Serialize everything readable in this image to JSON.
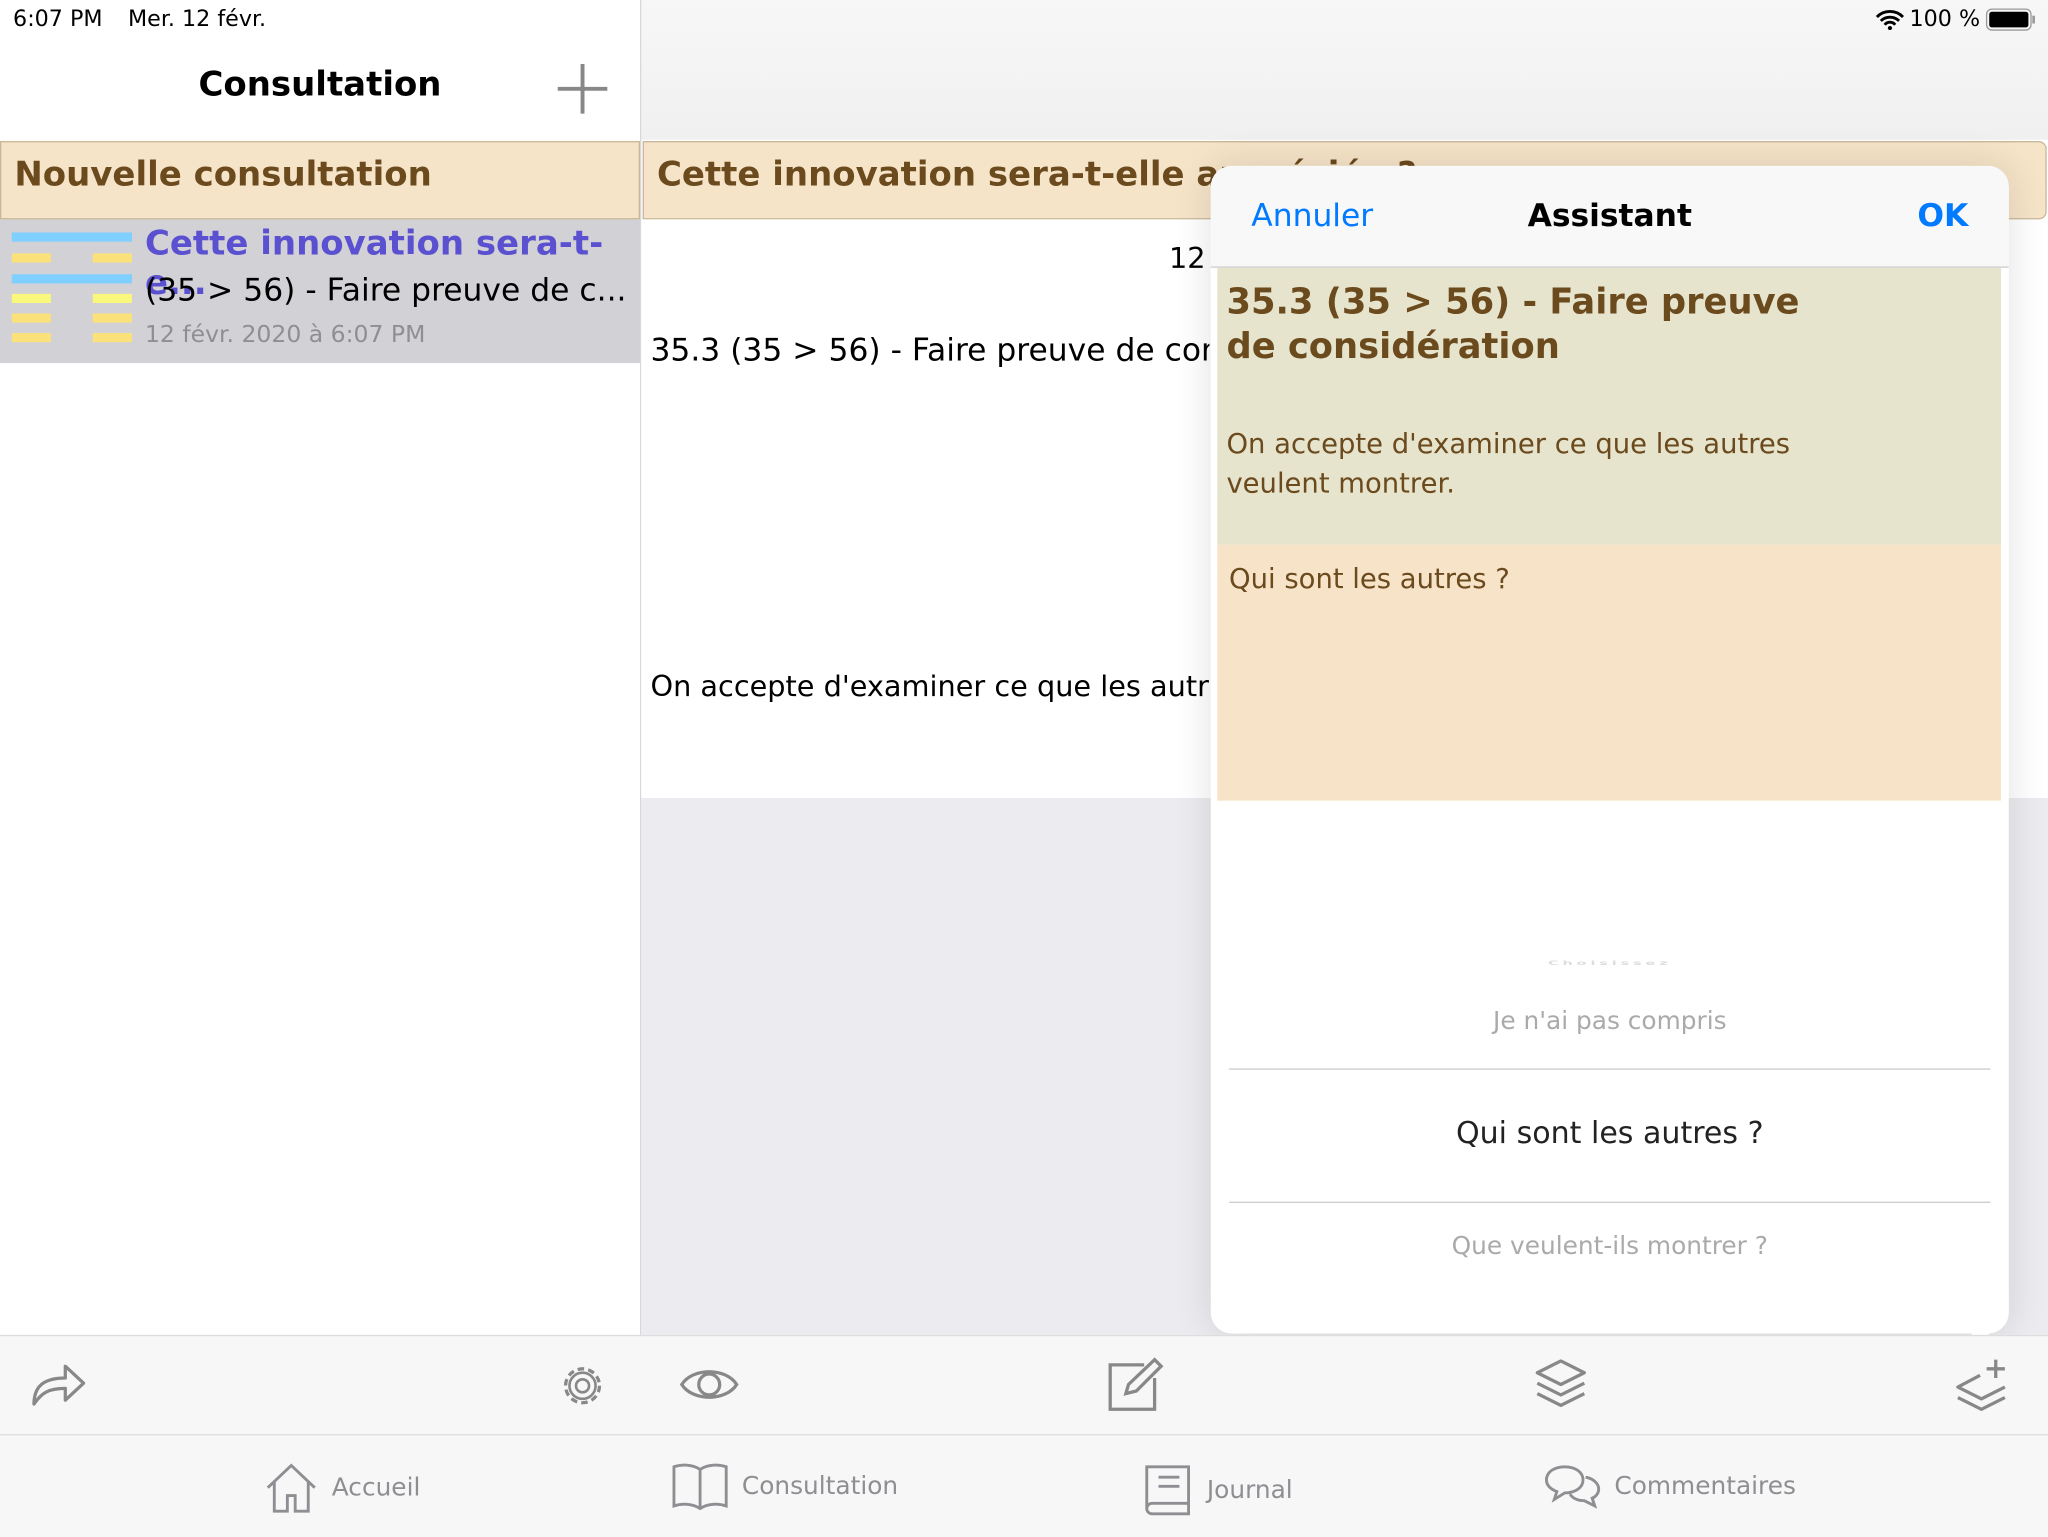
{
  "status_bar": {
    "time": "6:07 PM",
    "date": "Mer. 12 févr.",
    "battery": "100 %"
  },
  "sidebar": {
    "title": "Consultation",
    "section": "Nouvelle consultation",
    "items": [
      {
        "title": "Cette innovation sera-t-e...",
        "subtitle": "(35 > 56) - Faire preuve de c...",
        "date": "12 févr. 2020 à 6:07 PM"
      }
    ]
  },
  "detail": {
    "header": "Cette innovation sera-t-elle appréciée ?",
    "number": "12",
    "line1": "35.3 (35 > 56) - Faire preuve de considération",
    "line2": "On accepte d'examiner ce que les autres veulent montrer."
  },
  "popover": {
    "cancel": "Annuler",
    "title": "Assistant",
    "ok": "OK",
    "heading": "35.3 (35 > 56) - Faire preuve de considération",
    "description": "On accepte d'examiner ce que les autres veulent montrer.",
    "answer": "Qui sont les autres ?",
    "picker": {
      "options": [
        "Choisissez",
        "Je n'ai pas compris",
        "Qui sont les autres ?",
        "Que veulent-ils montrer ?"
      ],
      "selected": "Qui sont les autres ?"
    }
  },
  "tabs": [
    {
      "label": "Accueil",
      "icon": "home-icon"
    },
    {
      "label": "Consultation",
      "icon": "book-open-icon"
    },
    {
      "label": "Journal",
      "icon": "journal-icon"
    },
    {
      "label": "Commentaires",
      "icon": "comments-icon"
    }
  ],
  "colors": {
    "accent": "#007aff",
    "brown": "#6b4a1e",
    "tan": "#f6e4c8",
    "green": "#e6e4cc",
    "link_title": "#5a50d0"
  }
}
